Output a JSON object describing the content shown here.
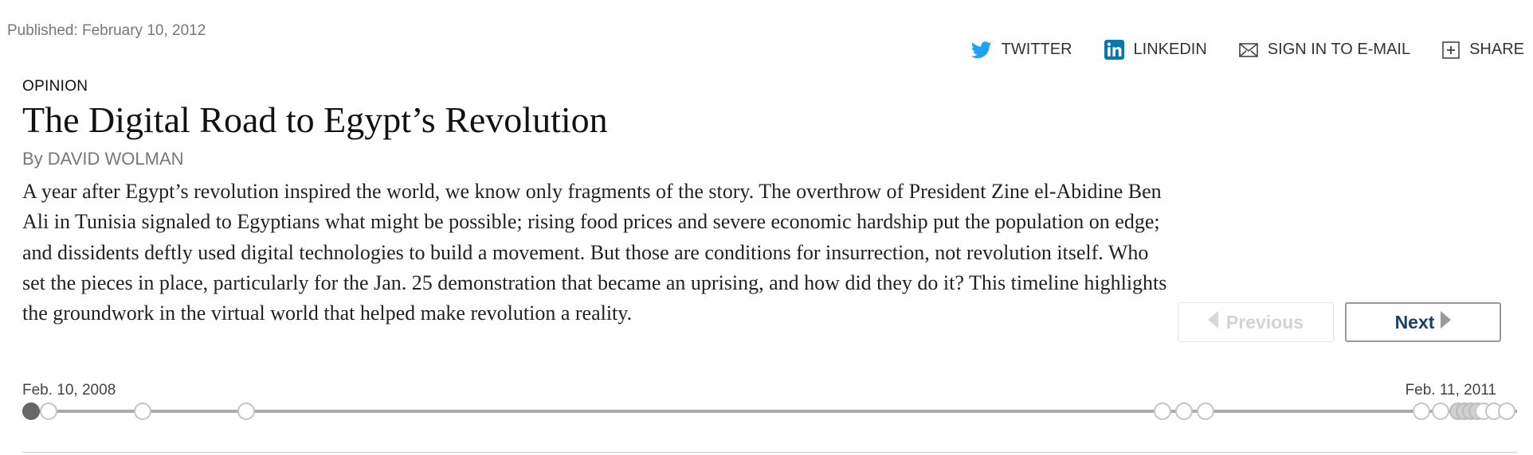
{
  "published": "Published: February 10, 2012",
  "share": {
    "twitter": "TWITTER",
    "linkedin": "LINKEDIN",
    "email": "SIGN IN TO E-MAIL",
    "share": "SHARE",
    "icons": [
      "twitter-icon",
      "linkedin-icon",
      "envelope-icon",
      "plus-box-icon"
    ],
    "colors": {
      "twitter": "#1da1f2",
      "linkedin": "#0e76a8"
    }
  },
  "article": {
    "kicker": "OPINION",
    "headline": "The Digital Road to Egypt’s Revolution",
    "byline": "By DAVID WOLMAN",
    "summary": "A year after Egypt’s revolution inspired the world, we know only fragments of the story. The overthrow of President Zine el-Abidine Ben Ali in Tunisia signaled to Egyptians what might be possible; rising food prices and severe economic hardship put the population on edge; and dissidents deftly used digital technologies to build a movement. But those are conditions for insurrection, not revolution itself. Who set the pieces in place, particularly for the Jan. 25 demonstration that became an uprising, and how did they do it? This timeline highlights the groundwork in the virtual world that helped make revolution a reality."
  },
  "nav": {
    "previous_label": "Previous",
    "next_label": "Next",
    "previous_enabled": false,
    "next_color": "#1b3f6b"
  },
  "timeline": {
    "start_label": "Feb. 10, 2008",
    "end_label": "Feb. 11, 2011",
    "event_count": 16,
    "selected_index": 0
  }
}
